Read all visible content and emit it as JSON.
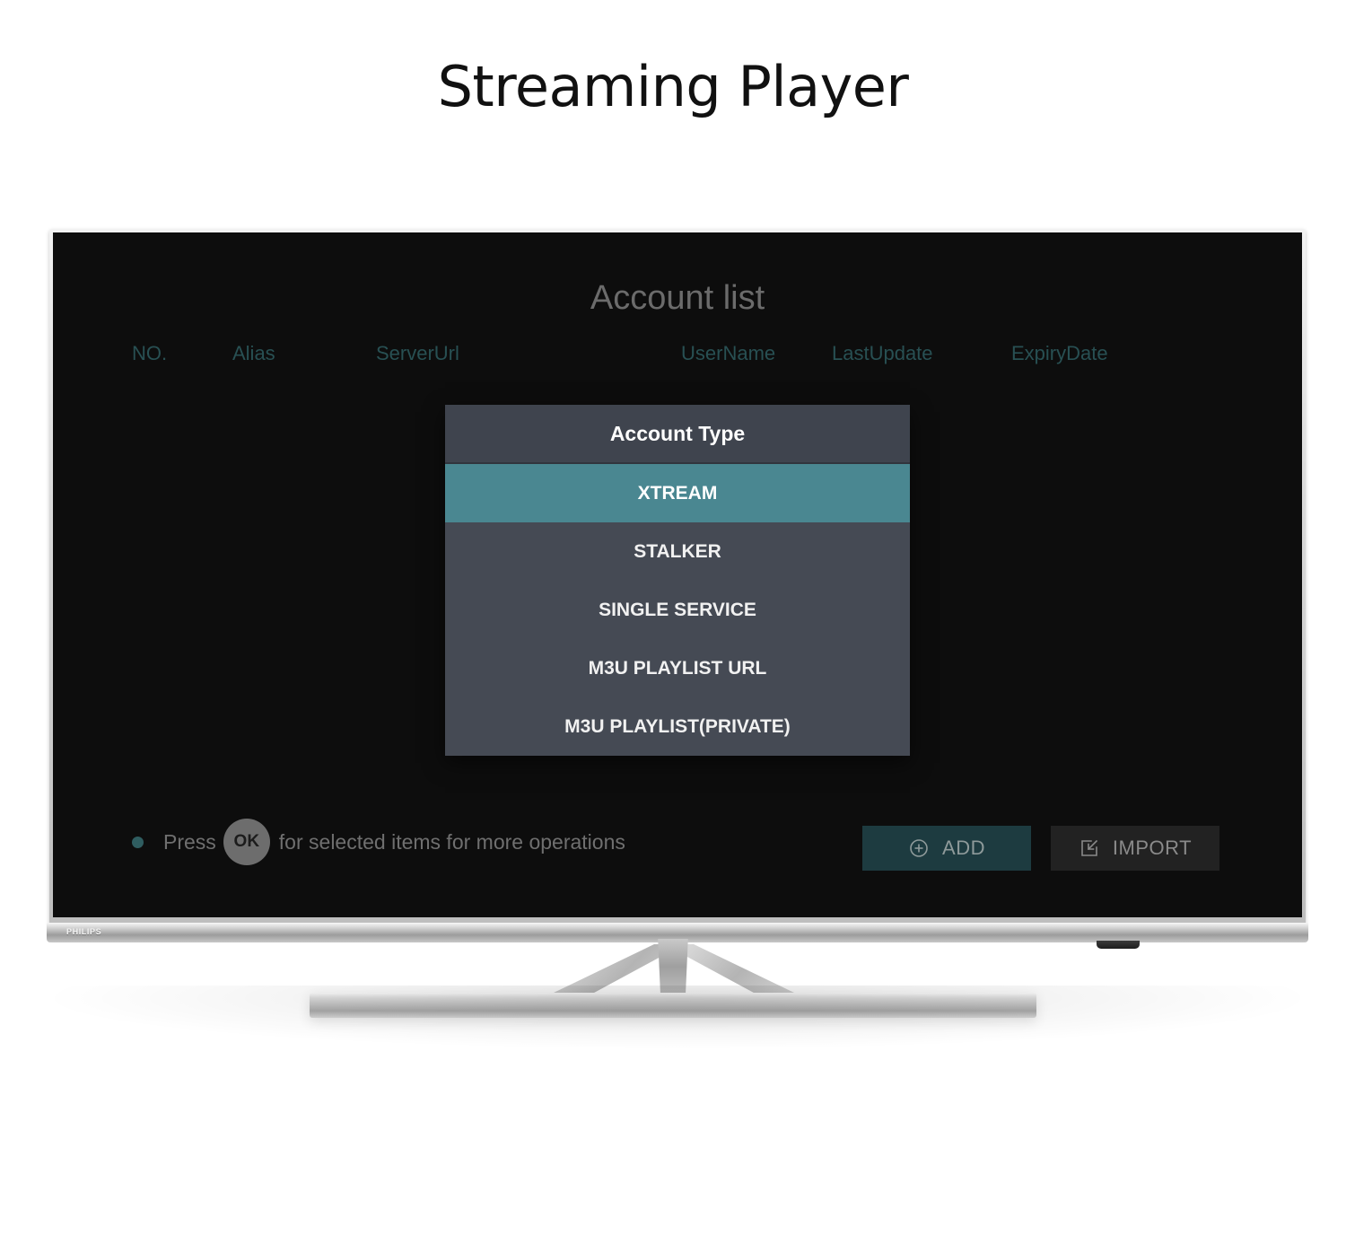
{
  "page": {
    "title": "Streaming Player",
    "background_color": "#ffffff"
  },
  "device": {
    "brand": "PHILIPS",
    "type": "television"
  },
  "screen": {
    "title": "Account list",
    "background_color": "#0d0d0d",
    "column_headers": [
      {
        "key": "no",
        "label": "NO."
      },
      {
        "key": "alias",
        "label": "Alias"
      },
      {
        "key": "server_url",
        "label": "ServerUrl"
      },
      {
        "key": "user_name",
        "label": "UserName"
      },
      {
        "key": "last_update",
        "label": "LastUpdate"
      },
      {
        "key": "expiry_date",
        "label": "ExpiryDate"
      }
    ],
    "column_header_color": "#285053",
    "rows": []
  },
  "dialog": {
    "title": "Account Type",
    "header_color": "#3f444e",
    "body_color": "#454a54",
    "selected_color": "#4a8791",
    "selected_index": 0,
    "items": [
      {
        "label": "XTREAM",
        "selected": true
      },
      {
        "label": "STALKER",
        "selected": false
      },
      {
        "label": "SINGLE SERVICE",
        "selected": false
      },
      {
        "label": "M3U PLAYLIST URL",
        "selected": false
      },
      {
        "label": "M3U PLAYLIST(PRIVATE)",
        "selected": false
      }
    ]
  },
  "footer": {
    "hint": {
      "prefix": "Press",
      "key": "OK",
      "suffix": "for selected items for more operations",
      "dot_color": "#2f5d60"
    },
    "buttons": [
      {
        "id": "add",
        "label": "ADD",
        "icon": "circle-plus-icon",
        "background": "#1d3b40"
      },
      {
        "id": "import",
        "label": "IMPORT",
        "icon": "import-icon",
        "background": "#222222"
      }
    ]
  }
}
